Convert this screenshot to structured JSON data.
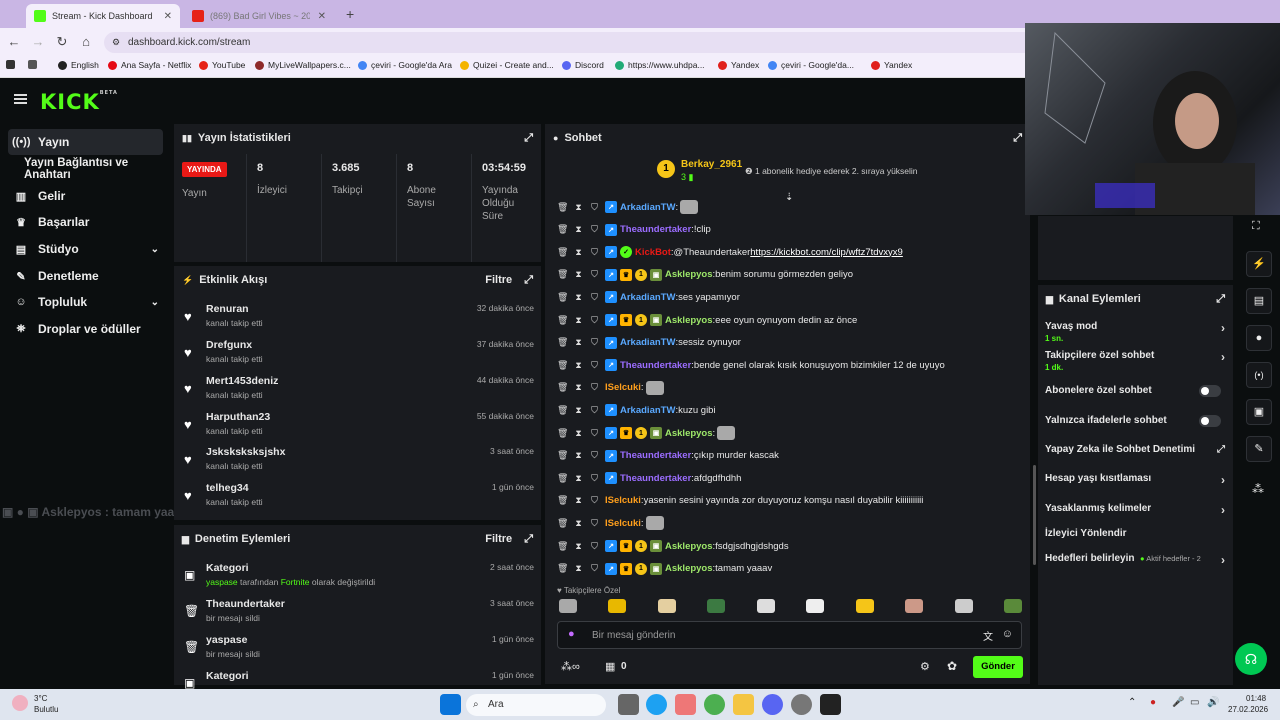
{
  "browser": {
    "tabs": [
      {
        "title": "Stream - Kick Dashboard",
        "active": true
      },
      {
        "title": "(869) Bad Girl Vibes ~ 200%",
        "active": false
      }
    ],
    "url": "dashboard.kick.com/stream",
    "bookmarks": [
      "English",
      "Ana Sayfa - Netflix",
      "YouTube",
      "MyLiveWallpapers.c...",
      "çeviri - Google'da Ara",
      "Quizei - Create and...",
      "Discord",
      "https://www.uhdpa...",
      "Yandex",
      "çeviri - Google'da...",
      "Yandex"
    ]
  },
  "header": {
    "logo": "KICK",
    "beta": "BETA"
  },
  "sidebar": {
    "items": [
      {
        "label": "Yayın",
        "icon": "broadcast-icon",
        "selected": true
      },
      {
        "label": "Yayın Bağlantısı ve Anahtarı",
        "icon": "",
        "selected": false
      },
      {
        "label": "Gelir",
        "icon": "chart-icon",
        "selected": false
      },
      {
        "label": "Başarılar",
        "icon": "trophy-icon",
        "selected": false
      },
      {
        "label": "Stüdyo",
        "icon": "studio-icon",
        "selected": false
      },
      {
        "label": "Denetleme",
        "icon": "wrench-icon",
        "selected": false
      },
      {
        "label": "Topluluk",
        "icon": "community-icon",
        "selected": false
      },
      {
        "label": "Droplar ve ödüller",
        "icon": "gift-icon",
        "selected": false
      }
    ]
  },
  "stats": {
    "title": "Yayın İstatistikleri",
    "live_badge": "YAYINDA",
    "live_label": "Yayın",
    "items": [
      {
        "value": "8",
        "label": "İzleyici"
      },
      {
        "value": "3.685",
        "label": "Takipçi"
      },
      {
        "value": "8",
        "label": "Abone Sayısı"
      },
      {
        "value": "03:54:59",
        "label": "Yayında Olduğu Süre"
      }
    ]
  },
  "activity": {
    "title": "Etkinlik Akışı",
    "filter": "Filtre",
    "items": [
      {
        "name": "Renuran",
        "sub": "kanalı takip etti",
        "time": "32 dakika önce"
      },
      {
        "name": "Drefgunx",
        "sub": "kanalı takip etti",
        "time": "37 dakika önce"
      },
      {
        "name": "Mert1453deniz",
        "sub": "kanalı takip etti",
        "time": "44 dakika önce"
      },
      {
        "name": "Harputhan23",
        "sub": "kanalı takip etti",
        "time": "55 dakika önce"
      },
      {
        "name": "Jsksksksksjshx",
        "sub": "kanalı takip etti",
        "time": "3 saat önce"
      },
      {
        "name": "telheg34",
        "sub": "kanalı takip etti",
        "time": "1 gün önce"
      }
    ]
  },
  "moderation": {
    "title": "Denetim Eylemleri",
    "filter": "Filtre",
    "items": [
      {
        "name": "Kategori",
        "user": "yaspase",
        "mid": " tarafından ",
        "cat": "Fortnite",
        "end": " olarak değiştirildi",
        "time": "2 saat önce"
      },
      {
        "name": "Theaundertaker",
        "sub": "bir mesajı sildi",
        "time": "3 saat önce"
      },
      {
        "name": "yaspase",
        "sub": "bir mesajı sildi",
        "time": "1 gün önce"
      },
      {
        "name": "Kategori",
        "sub": "",
        "time": "1 gün önce"
      }
    ]
  },
  "overlay_text": "Asklepyos : tamam yaaav",
  "chat": {
    "title": "Sohbet",
    "gifter": {
      "name": "Berkay_2961",
      "rank": "1",
      "count": "3",
      "note": "1 abonelik hediye ederek 2. sıraya yükselin"
    },
    "messages": [
      {
        "user": "ArkadianTW",
        "color": "#5aa9ff",
        "text": "",
        "emote": true,
        "badges": [
          "v"
        ]
      },
      {
        "user": "Theaundertaker",
        "color": "#9b6dff",
        "text": "!clip",
        "badges": [
          "v"
        ]
      },
      {
        "user": "KickBot",
        "color": "#e91916",
        "text": "@Theaundertaker ",
        "link": "https://kickbot.com/clip/wftz7tdvxyx9",
        "badges": [
          "v",
          "k"
        ]
      },
      {
        "user": "Asklepyos",
        "color": "#9ee86a",
        "text": "benim sorumu görmezden geliyo",
        "badges": [
          "v",
          "c",
          "g",
          "s"
        ]
      },
      {
        "user": "ArkadianTW",
        "color": "#5aa9ff",
        "text": "ses yapamıyor",
        "badges": [
          "v"
        ]
      },
      {
        "user": "Asklepyos",
        "color": "#9ee86a",
        "text": "eee oyun oynuyom dedin az önce",
        "badges": [
          "v",
          "c",
          "g",
          "s"
        ]
      },
      {
        "user": "ArkadianTW",
        "color": "#5aa9ff",
        "text": "sessiz oynuyor",
        "badges": [
          "v"
        ]
      },
      {
        "user": "Theaundertaker",
        "color": "#9b6dff",
        "text": "bende genel olarak kısık konuşuyom bizimkiler 12 de uyuyo",
        "badges": [
          "v"
        ]
      },
      {
        "user": "ISelcuki",
        "color": "#ff9f1c",
        "text": "",
        "emote": true,
        "badges": []
      },
      {
        "user": "ArkadianTW",
        "color": "#5aa9ff",
        "text": "kuzu gibi",
        "badges": [
          "v"
        ]
      },
      {
        "user": "Asklepyos",
        "color": "#9ee86a",
        "text": "",
        "emote": true,
        "badges": [
          "v",
          "c",
          "g",
          "s"
        ]
      },
      {
        "user": "Theaundertaker",
        "color": "#9b6dff",
        "text": "çıkıp murder kascak",
        "badges": [
          "v"
        ]
      },
      {
        "user": "Theaundertaker",
        "color": "#9b6dff",
        "text": "afdgdfhdhh",
        "badges": [
          "v"
        ]
      },
      {
        "user": "ISelcuki",
        "color": "#ff9f1c",
        "text": "yasenin sesini yayında zor duyuyoruz komşu nasıl duyabilir kiiiiiiiiiii",
        "badges": []
      },
      {
        "user": "ISelcuki",
        "color": "#ff9f1c",
        "text": "",
        "emote": true,
        "badges": []
      },
      {
        "user": "Asklepyos",
        "color": "#9ee86a",
        "text": "fsdgjsdhgjdshgds",
        "badges": [
          "v",
          "c",
          "g",
          "s"
        ]
      },
      {
        "user": "Asklepyos",
        "color": "#9ee86a",
        "text": "tamam yaaav",
        "badges": [
          "v",
          "c",
          "g",
          "s"
        ]
      }
    ],
    "followers_only_label": "Takipçilere Özel",
    "input_placeholder": "Bir mesaj gönderin",
    "points": "0",
    "send_label": "Gönder"
  },
  "channel_actions": {
    "title": "Kanal Eylemleri",
    "items": [
      {
        "label": "Yavaş mod",
        "sub": "1 sn.",
        "control": "chevron"
      },
      {
        "label": "Takipçilere özel sohbet",
        "sub": "1 dk.",
        "control": "chevron"
      },
      {
        "label": "Abonelere özel sohbet",
        "sub": "",
        "control": "toggle"
      },
      {
        "label": "Yalnızca ifadelerle sohbet",
        "sub": "",
        "control": "toggle"
      },
      {
        "label": "Yapay Zeka ile Sohbet Denetimi",
        "sub": "",
        "control": "external"
      },
      {
        "label": "Hesap yaşı kısıtlaması",
        "sub": "",
        "control": "chevron"
      },
      {
        "label": "Yasaklanmış kelimeler",
        "sub": "",
        "control": "chevron"
      },
      {
        "label": "İzleyici Yönlendir",
        "sub": "",
        "control": "none"
      },
      {
        "label": "Hedefleri belirleyin",
        "sub": "",
        "control": "chevron",
        "extra": "Aktif hedefler - 2"
      }
    ]
  },
  "taskbar": {
    "weather_temp": "3°C",
    "weather_desc": "Bulutlu",
    "search": "Ara",
    "time": "01:48",
    "date": "27.02.2026"
  },
  "colors": {
    "kick_green": "#53fc18",
    "live_red": "#e91916",
    "panel_bg": "#191b1f"
  }
}
